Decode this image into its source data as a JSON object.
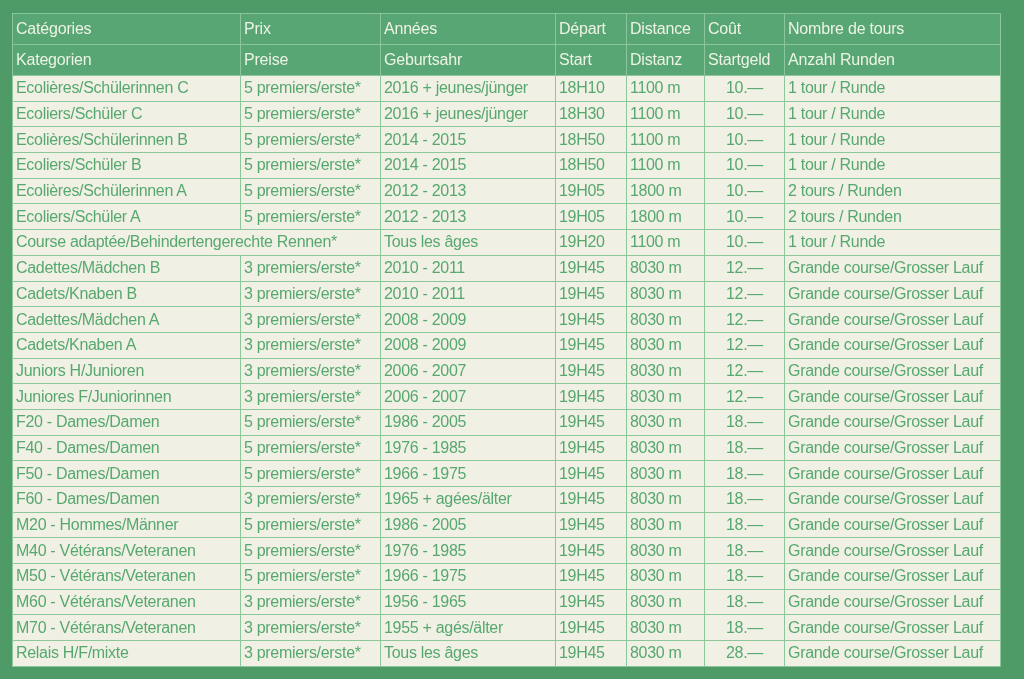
{
  "table": {
    "header_rows": [
      [
        "Catégories",
        "Prix",
        "Années",
        "Départ",
        "Distance",
        "Coût",
        "Nombre de tours"
      ],
      [
        "Kategorien",
        "Preise",
        "Geburtsahr",
        "Start",
        "Distanz",
        "Startgeld",
        "Anzahl Runden"
      ]
    ],
    "rows": [
      {
        "category": "Ecolières/Schülerinnen C",
        "prize": "5 premiers/erste*",
        "years": "2016 + jeunes/jünger",
        "start": "18H10",
        "distance": "1100 m",
        "fee": "10.—",
        "laps": "1 tour / Runde"
      },
      {
        "category": "Ecoliers/Schüler C",
        "prize": "5 premiers/erste*",
        "years": "2016 + jeunes/jünger",
        "start": "18H30",
        "distance": "1100 m",
        "fee": "10.—",
        "laps": "1 tour / Runde"
      },
      {
        "category": "Ecolières/Schülerinnen B",
        "prize": "5 premiers/erste*",
        "years": "2014 - 2015",
        "start": "18H50",
        "distance": "1100 m",
        "fee": "10.—",
        "laps": "1 tour / Runde"
      },
      {
        "category": "Ecoliers/Schüler B",
        "prize": "5 premiers/erste*",
        "years": "2014 - 2015",
        "start": "18H50",
        "distance": "1100 m",
        "fee": "10.—",
        "laps": "1 tour / Runde"
      },
      {
        "category": "Ecolières/Schülerinnen A",
        "prize": "5 premiers/erste*",
        "years": "2012 - 2013",
        "start": "19H05",
        "distance": "1800 m",
        "fee": "10.—",
        "laps": "2 tours / Runden"
      },
      {
        "category": "Ecoliers/Schüler A",
        "prize": "5 premiers/erste*",
        "years": "2012 - 2013",
        "start": "19H05",
        "distance": "1800 m",
        "fee": "10.—",
        "laps": "2 tours / Runden"
      },
      {
        "category": "Course adaptée/Behindertengerechte Rennen*",
        "years": "Tous les âges",
        "start": "19H20",
        "distance": "1100 m",
        "fee": "10.—",
        "laps": "1 tour / Runde"
      },
      {
        "category": "Cadettes/Mädchen B",
        "prize": "3 premiers/erste*",
        "years": "2010 - 2011",
        "start": "19H45",
        "distance": "8030 m",
        "fee": "12.—",
        "laps": "Grande course/Grosser Lauf"
      },
      {
        "category": "Cadets/Knaben B",
        "prize": "3 premiers/erste*",
        "years": "2010 - 2011",
        "start": "19H45",
        "distance": "8030 m",
        "fee": "12.—",
        "laps": "Grande course/Grosser Lauf"
      },
      {
        "category": "Cadettes/Mädchen A",
        "prize": "3 premiers/erste*",
        "years": "2008 - 2009",
        "start": "19H45",
        "distance": "8030 m",
        "fee": "12.—",
        "laps": "Grande course/Grosser Lauf"
      },
      {
        "category": "Cadets/Knaben A",
        "prize": "3 premiers/erste*",
        "years": "2008 - 2009",
        "start": "19H45",
        "distance": "8030 m",
        "fee": "12.—",
        "laps": "Grande course/Grosser Lauf"
      },
      {
        "category": "Juniors H/Junioren",
        "prize": "3 premiers/erste*",
        "years": "2006 - 2007",
        "start": "19H45",
        "distance": "8030 m",
        "fee": "12.—",
        "laps": "Grande course/Grosser Lauf"
      },
      {
        "category": "Juniores F/Juniorinnen",
        "prize": "3 premiers/erste*",
        "years": "2006 - 2007",
        "start": "19H45",
        "distance": "8030 m",
        "fee": "12.—",
        "laps": "Grande course/Grosser Lauf"
      },
      {
        "category": "F20 - Dames/Damen",
        "prize": "5 premiers/erste*",
        "years": "1986 - 2005",
        "start": "19H45",
        "distance": "8030 m",
        "fee": "18.—",
        "laps": "Grande course/Grosser Lauf"
      },
      {
        "category": "F40 - Dames/Damen",
        "prize": "5 premiers/erste*",
        "years": "1976 - 1985",
        "start": "19H45",
        "distance": "8030 m",
        "fee": "18.—",
        "laps": "Grande course/Grosser Lauf"
      },
      {
        "category": "F50 - Dames/Damen",
        "prize": "5 premiers/erste*",
        "years": "1966 - 1975",
        "start": "19H45",
        "distance": "8030 m",
        "fee": "18.—",
        "laps": "Grande course/Grosser Lauf"
      },
      {
        "category": "F60 - Dames/Damen",
        "prize": "3 premiers/erste*",
        "years": "1965 + agées/älter",
        "start": "19H45",
        "distance": "8030 m",
        "fee": "18.—",
        "laps": "Grande course/Grosser Lauf"
      },
      {
        "category": "M20 - Hommes/Männer",
        "prize": "5 premiers/erste*",
        "years": "1986 - 2005",
        "start": "19H45",
        "distance": "8030 m",
        "fee": "18.—",
        "laps": "Grande course/Grosser Lauf"
      },
      {
        "category": "M40 - Vétérans/Veteranen",
        "prize": "5 premiers/erste*",
        "years": "1976 - 1985",
        "start": "19H45",
        "distance": "8030 m",
        "fee": "18.—",
        "laps": "Grande course/Grosser Lauf"
      },
      {
        "category": "M50 - Vétérans/Veteranen",
        "prize": "5 premiers/erste*",
        "years": "1966 - 1975",
        "start": "19H45",
        "distance": "8030 m",
        "fee": "18.—",
        "laps": "Grande course/Grosser Lauf"
      },
      {
        "category": "M60 - Vétérans/Veteranen",
        "prize": "3 premiers/erste*",
        "years": "1956 - 1965",
        "start": "19H45",
        "distance": "8030 m",
        "fee": "18.—",
        "laps": "Grande course/Grosser Lauf"
      },
      {
        "category": "M70 - Vétérans/Veteranen",
        "prize": "3 premiers/erste*",
        "years": "1955 + agés/älter",
        "start": "19H45",
        "distance": "8030 m",
        "fee": "18.—",
        "laps": "Grande course/Grosser Lauf"
      },
      {
        "category": "Relais H/F/mixte",
        "prize": "3 premiers/erste*",
        "years": "Tous les âges",
        "start": "19H45",
        "distance": "8030 m",
        "fee": "28.—",
        "laps": "Grande course/Grosser Lauf"
      }
    ]
  }
}
